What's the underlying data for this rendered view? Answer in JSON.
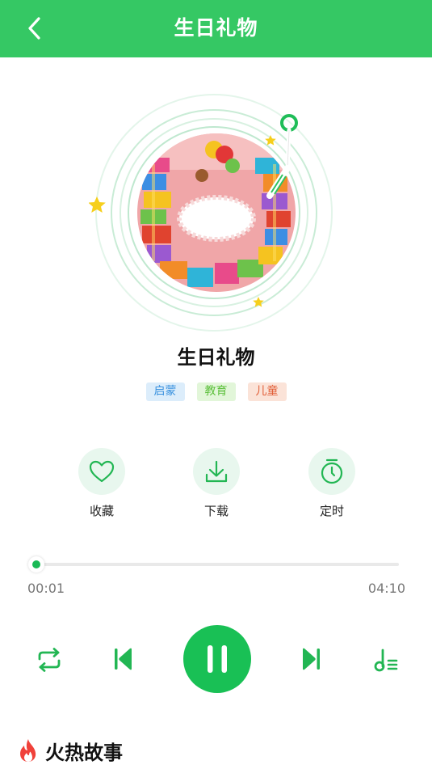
{
  "header": {
    "title": "生日礼物"
  },
  "song": {
    "title": "生日礼物",
    "tags": [
      "启蒙",
      "教育",
      "儿童"
    ]
  },
  "actions": {
    "favorite_label": "收藏",
    "download_label": "下载",
    "timer_label": "定时"
  },
  "player": {
    "current_time": "00:01",
    "total_time": "04:10",
    "progress": 0.004,
    "state": "playing"
  },
  "section": {
    "hot_title": "火热故事"
  },
  "colors": {
    "brand_green": "#35c864",
    "play_green": "#19c055",
    "action_bg": "#e8f7ee"
  }
}
